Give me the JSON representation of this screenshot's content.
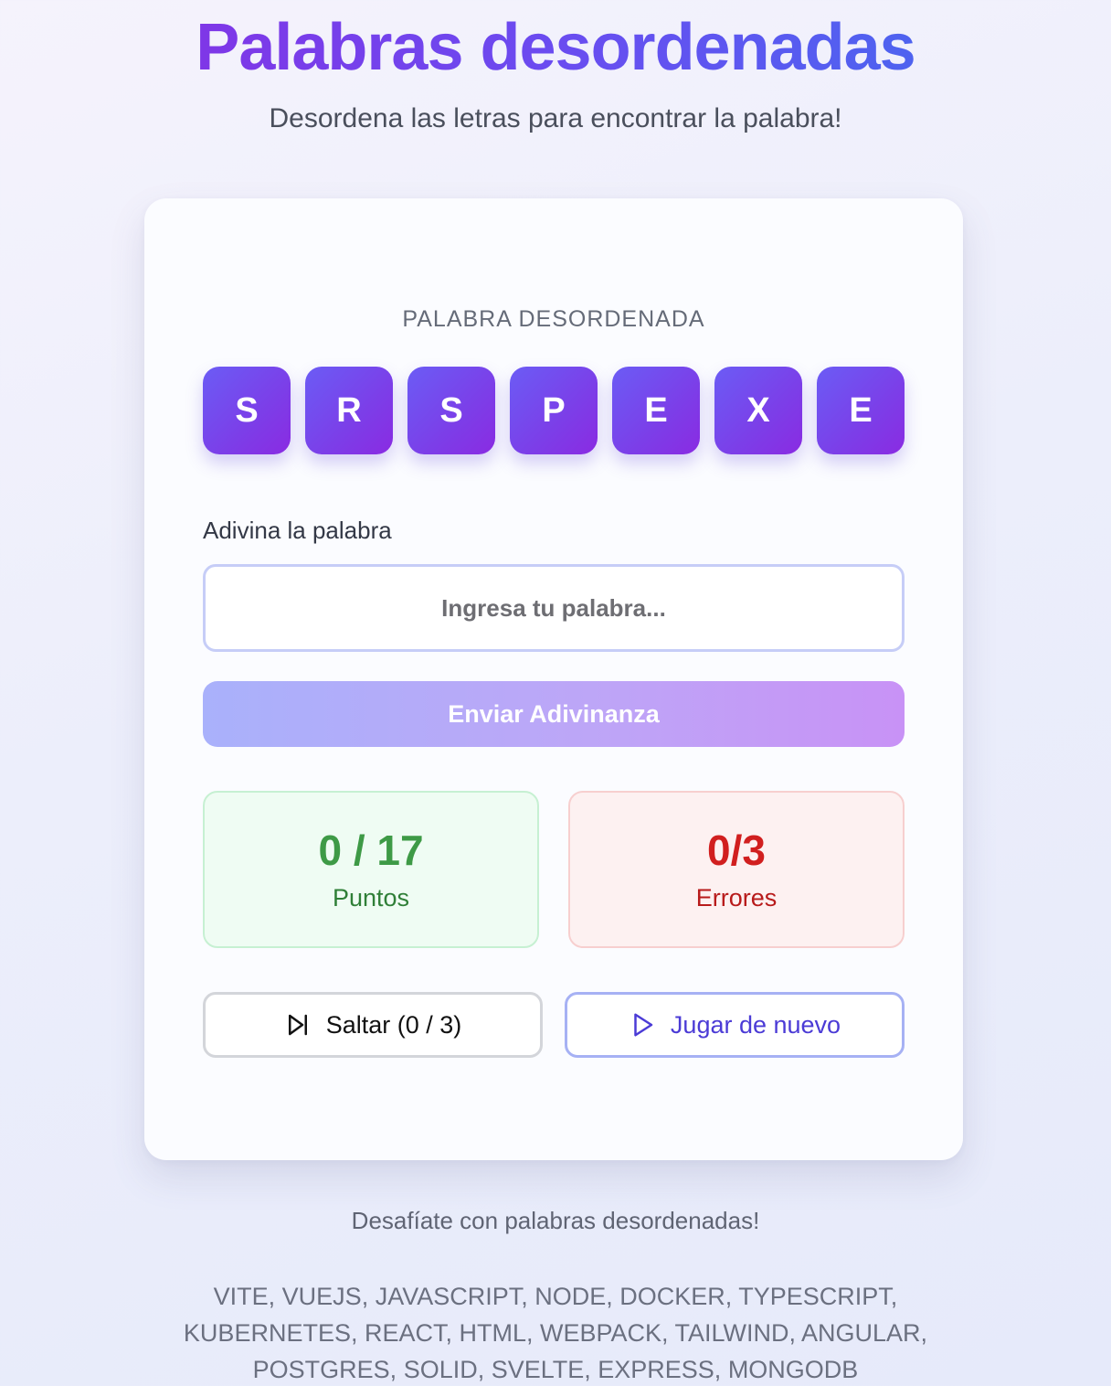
{
  "header": {
    "title": "Palabras desordenadas",
    "subtitle": "Desordena las letras para encontrar la palabra!"
  },
  "game": {
    "scrambled_label": "PALABRA DESORDENADA",
    "letters": [
      "S",
      "R",
      "S",
      "P",
      "E",
      "X",
      "E"
    ],
    "guess_label": "Adivina la palabra",
    "guess_input": {
      "value": "",
      "placeholder": "Ingresa tu palabra..."
    },
    "submit_label": "Enviar Adivinanza",
    "stats": {
      "points_value": "0 / 17",
      "points_label": "Puntos",
      "errors_value": "0/3",
      "errors_label": "Errores"
    },
    "skip_label": "Saltar (0 / 3)",
    "skip_icon": "skip-forward-icon",
    "replay_label": "Jugar de nuevo",
    "replay_icon": "play-icon"
  },
  "footer": {
    "tagline": "Desafíate con palabras desordenadas!",
    "word_list": "VITE, VUEJS, JAVASCRIPT, NODE, DOCKER, TYPESCRIPT, KUBERNETES, REACT, HTML, WEBPACK, TAILWIND, ANGULAR, POSTGRES, SOLID, SVELTE, EXPRESS, MONGODB"
  },
  "colors": {
    "accent_purple": "#8a2be2",
    "accent_blue": "#3f6fef",
    "success": "#3e9a46",
    "error": "#d11f1f"
  }
}
